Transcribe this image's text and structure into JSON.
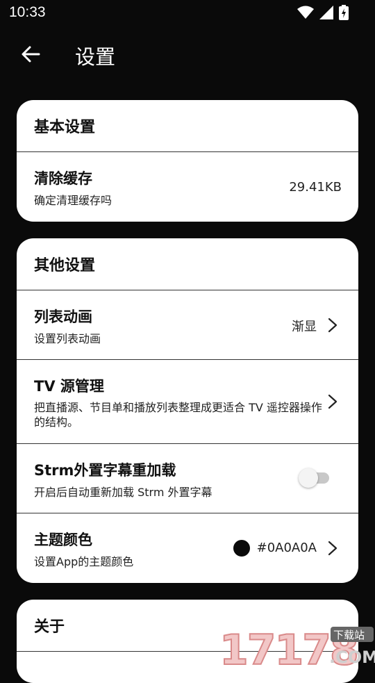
{
  "status": {
    "time": "10:33"
  },
  "appbar": {
    "title": "设置"
  },
  "basic": {
    "header": "基本设置",
    "clear_cache": {
      "title": "清除缓存",
      "subtitle": "确定清理缓存吗",
      "value": "29.41KB"
    }
  },
  "other": {
    "header": "其他设置",
    "list_anim": {
      "title": "列表动画",
      "subtitle": "设置列表动画",
      "value": "渐显"
    },
    "tv_source": {
      "title": "TV 源管理",
      "subtitle": "把直播源、节目单和播放列表整理成更适合 TV 遥控器操作的结构。"
    },
    "strm": {
      "title": "Strm外置字幕重加载",
      "subtitle": "开启后自动重新加载 Strm 外置字幕",
      "enabled": false
    },
    "theme_color": {
      "title": "主题颜色",
      "subtitle": "设置App的主题颜色",
      "value": "#0A0A0A",
      "color": "#0A0A0A"
    }
  },
  "about": {
    "header": "关于"
  },
  "watermark": {
    "number": "17178",
    "badge": "下载站",
    "domain": ".COM"
  }
}
